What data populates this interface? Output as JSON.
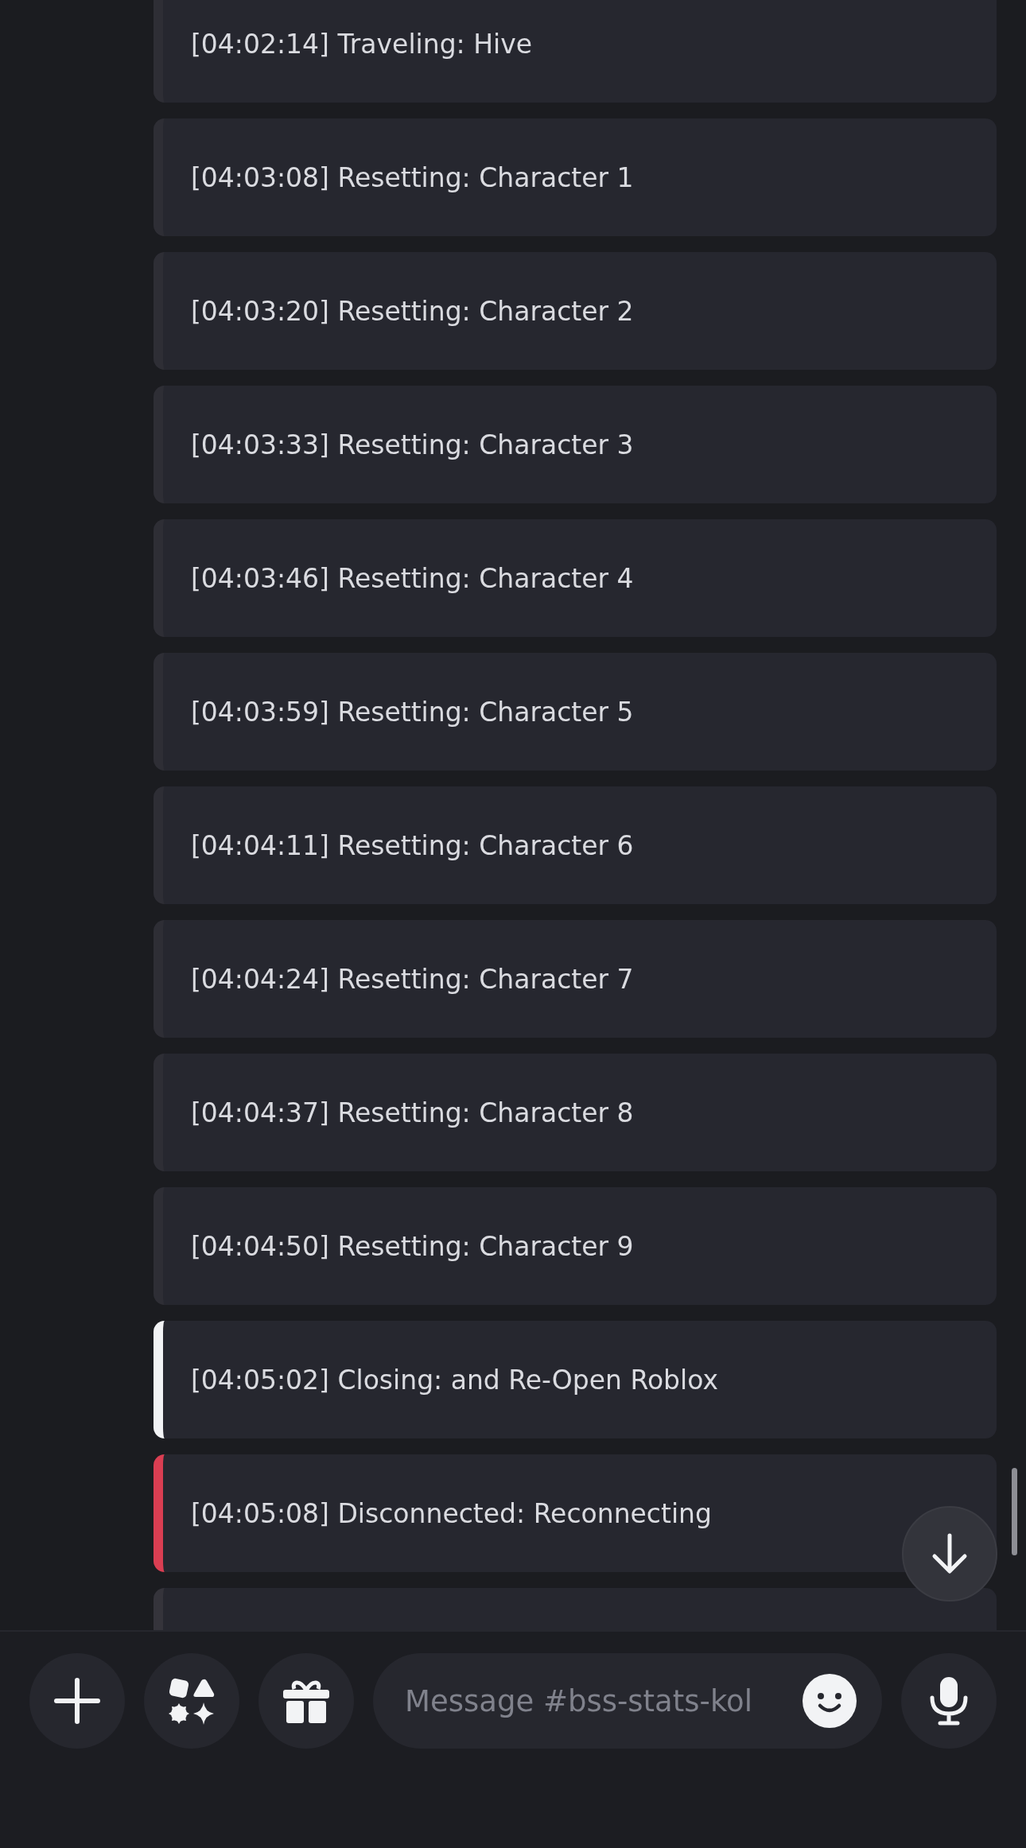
{
  "messages": [
    {
      "text": "[04:02:14] Traveling: Hive",
      "color": "#2e2e35"
    },
    {
      "text": "[04:03:08] Resetting: Character 1",
      "color": "#2e2e35"
    },
    {
      "text": "[04:03:20] Resetting: Character 2",
      "color": "#2e2e35"
    },
    {
      "text": "[04:03:33] Resetting: Character 3",
      "color": "#2e2e35"
    },
    {
      "text": "[04:03:46] Resetting: Character 4",
      "color": "#2e2e35"
    },
    {
      "text": "[04:03:59] Resetting: Character 5",
      "color": "#2e2e35"
    },
    {
      "text": "[04:04:11] Resetting: Character 6",
      "color": "#2e2e35"
    },
    {
      "text": "[04:04:24] Resetting: Character 7",
      "color": "#2e2e35"
    },
    {
      "text": "[04:04:37] Resetting: Character 8",
      "color": "#2e2e35"
    },
    {
      "text": "[04:04:50] Resetting: Character 9",
      "color": "#2e2e35"
    },
    {
      "text": "[04:05:02] Closing: and Re-Open Roblox",
      "color": "#f2f3f5"
    },
    {
      "text": "[04:05:08] Disconnected: Reconnecting",
      "color": "#da3e52"
    },
    {
      "color": "#35343b"
    }
  ],
  "composer": {
    "placeholder": "Message #bss-stats-kol"
  }
}
